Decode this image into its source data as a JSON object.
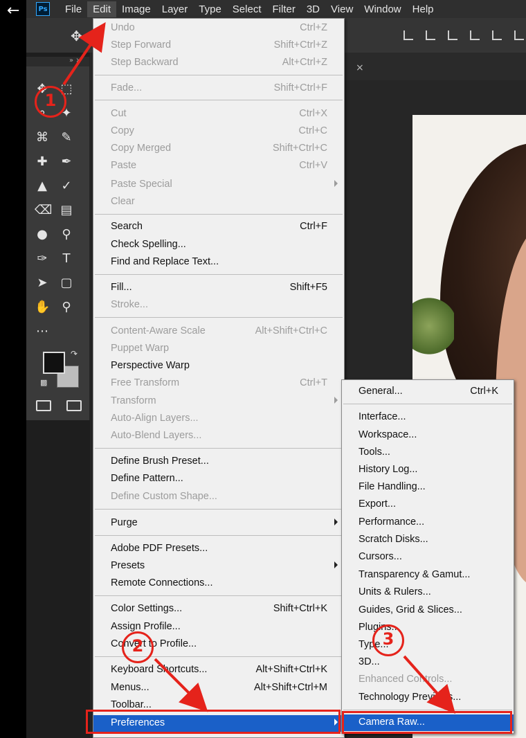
{
  "menubar": {
    "app_logo": "Ps",
    "items": [
      "File",
      "Edit",
      "Image",
      "Layer",
      "Type",
      "Select",
      "Filter",
      "3D",
      "View",
      "Window",
      "Help"
    ]
  },
  "edit_menu": {
    "items": [
      {
        "label": "Undo",
        "shortcut": "Ctrl+Z",
        "disabled": true
      },
      {
        "label": "Step Forward",
        "shortcut": "Shift+Ctrl+Z",
        "disabled": true
      },
      {
        "label": "Step Backward",
        "shortcut": "Alt+Ctrl+Z",
        "disabled": true
      },
      {
        "label": "Fade...",
        "shortcut": "Shift+Ctrl+F",
        "disabled": true
      },
      {
        "label": "Cut",
        "shortcut": "Ctrl+X",
        "disabled": true
      },
      {
        "label": "Copy",
        "shortcut": "Ctrl+C",
        "disabled": true
      },
      {
        "label": "Copy Merged",
        "shortcut": "Shift+Ctrl+C",
        "disabled": true
      },
      {
        "label": "Paste",
        "shortcut": "Ctrl+V",
        "disabled": true
      },
      {
        "label": "Paste Special",
        "shortcut": "",
        "disabled": true
      },
      {
        "label": "Clear",
        "shortcut": "",
        "disabled": true
      },
      {
        "label": "Search",
        "shortcut": "Ctrl+F",
        "disabled": false
      },
      {
        "label": "Check Spelling...",
        "shortcut": "",
        "disabled": false
      },
      {
        "label": "Find and Replace Text...",
        "shortcut": "",
        "disabled": false
      },
      {
        "label": "Fill...",
        "shortcut": "Shift+F5",
        "disabled": false
      },
      {
        "label": "Stroke...",
        "shortcut": "",
        "disabled": true
      },
      {
        "label": "Content-Aware Scale",
        "shortcut": "Alt+Shift+Ctrl+C",
        "disabled": true
      },
      {
        "label": "Puppet Warp",
        "shortcut": "",
        "disabled": true
      },
      {
        "label": "Perspective Warp",
        "shortcut": "",
        "disabled": false
      },
      {
        "label": "Free Transform",
        "shortcut": "Ctrl+T",
        "disabled": true
      },
      {
        "label": "Transform",
        "shortcut": "",
        "disabled": true
      },
      {
        "label": "Auto-Align Layers...",
        "shortcut": "",
        "disabled": true
      },
      {
        "label": "Auto-Blend Layers...",
        "shortcut": "",
        "disabled": true
      },
      {
        "label": "Define Brush Preset...",
        "shortcut": "",
        "disabled": false
      },
      {
        "label": "Define Pattern...",
        "shortcut": "",
        "disabled": false
      },
      {
        "label": "Define Custom Shape...",
        "shortcut": "",
        "disabled": true
      },
      {
        "label": "Purge",
        "shortcut": "",
        "disabled": false
      },
      {
        "label": "Adobe PDF Presets...",
        "shortcut": "",
        "disabled": false
      },
      {
        "label": "Presets",
        "shortcut": "",
        "disabled": false
      },
      {
        "label": "Remote Connections...",
        "shortcut": "",
        "disabled": false
      },
      {
        "label": "Color Settings...",
        "shortcut": "Shift+Ctrl+K",
        "disabled": false
      },
      {
        "label": "Assign Profile...",
        "shortcut": "",
        "disabled": false
      },
      {
        "label": "Convert to Profile...",
        "shortcut": "",
        "disabled": false
      },
      {
        "label": "Keyboard Shortcuts...",
        "shortcut": "Alt+Shift+Ctrl+K",
        "disabled": false
      },
      {
        "label": "Menus...",
        "shortcut": "Alt+Shift+Ctrl+M",
        "disabled": false
      },
      {
        "label": "Toolbar...",
        "shortcut": "",
        "disabled": false
      },
      {
        "label": "Preferences",
        "shortcut": "",
        "disabled": false
      }
    ]
  },
  "preferences_menu": {
    "items": [
      {
        "label": "General...",
        "shortcut": "Ctrl+K",
        "disabled": false
      },
      {
        "label": "Interface...",
        "shortcut": "",
        "disabled": false
      },
      {
        "label": "Workspace...",
        "shortcut": "",
        "disabled": false
      },
      {
        "label": "Tools...",
        "shortcut": "",
        "disabled": false
      },
      {
        "label": "History Log...",
        "shortcut": "",
        "disabled": false
      },
      {
        "label": "File Handling...",
        "shortcut": "",
        "disabled": false
      },
      {
        "label": "Export...",
        "shortcut": "",
        "disabled": false
      },
      {
        "label": "Performance...",
        "shortcut": "",
        "disabled": false
      },
      {
        "label": "Scratch Disks...",
        "shortcut": "",
        "disabled": false
      },
      {
        "label": "Cursors...",
        "shortcut": "",
        "disabled": false
      },
      {
        "label": "Transparency & Gamut...",
        "shortcut": "",
        "disabled": false
      },
      {
        "label": "Units & Rulers...",
        "shortcut": "",
        "disabled": false
      },
      {
        "label": "Guides, Grid & Slices...",
        "shortcut": "",
        "disabled": false
      },
      {
        "label": "Plugins...",
        "shortcut": "",
        "disabled": false
      },
      {
        "label": "Type...",
        "shortcut": "",
        "disabled": false
      },
      {
        "label": "3D...",
        "shortcut": "",
        "disabled": false
      },
      {
        "label": "Enhanced Controls...",
        "shortcut": "",
        "disabled": true
      },
      {
        "label": "Technology Previews...",
        "shortcut": "",
        "disabled": false
      },
      {
        "label": "Camera Raw...",
        "shortcut": "",
        "disabled": false
      }
    ]
  },
  "annotations": {
    "step1": "1",
    "step2": "2",
    "step3": "3",
    "color": "#e5231b"
  },
  "colors": {
    "highlight": "#1a60c8",
    "menu_bg": "#f0f0f0"
  }
}
